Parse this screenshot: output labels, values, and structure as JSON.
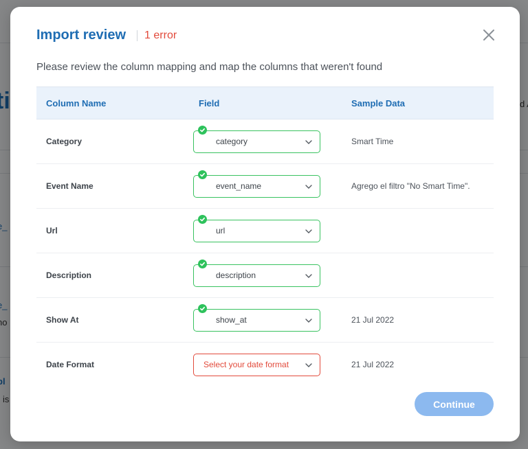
{
  "modal": {
    "title": "Import review",
    "error_count": "1 error",
    "subtitle": "Please review the column mapping and map the columns that weren't found",
    "continue_label": "Continue"
  },
  "table": {
    "headers": [
      "Column Name",
      "Field",
      "Sample Data"
    ],
    "rows": [
      {
        "column": "Category",
        "field": "category",
        "sample": "Smart Time",
        "status": "mapped"
      },
      {
        "column": "Event Name",
        "field": "event_name",
        "sample": "Agrego el filtro \"No Smart Time\".",
        "status": "mapped"
      },
      {
        "column": "Url",
        "field": "url",
        "sample": "",
        "status": "mapped"
      },
      {
        "column": "Description",
        "field": "description",
        "sample": "",
        "status": "mapped"
      },
      {
        "column": "Show At",
        "field": "show_at",
        "sample": "21 Jul 2022",
        "status": "mapped"
      },
      {
        "column": "Date Format",
        "field": "Select your date format",
        "sample": "21 Jul 2022",
        "status": "error"
      }
    ]
  },
  "background": {
    "fragments": [
      "ti",
      "e_",
      "e_",
      "no",
      "pl",
      "is",
      "d A"
    ]
  },
  "colors": {
    "accent": "#1f6db3",
    "error": "#e24a3b",
    "success": "#2ec25c",
    "button": "#8cb9ef"
  }
}
